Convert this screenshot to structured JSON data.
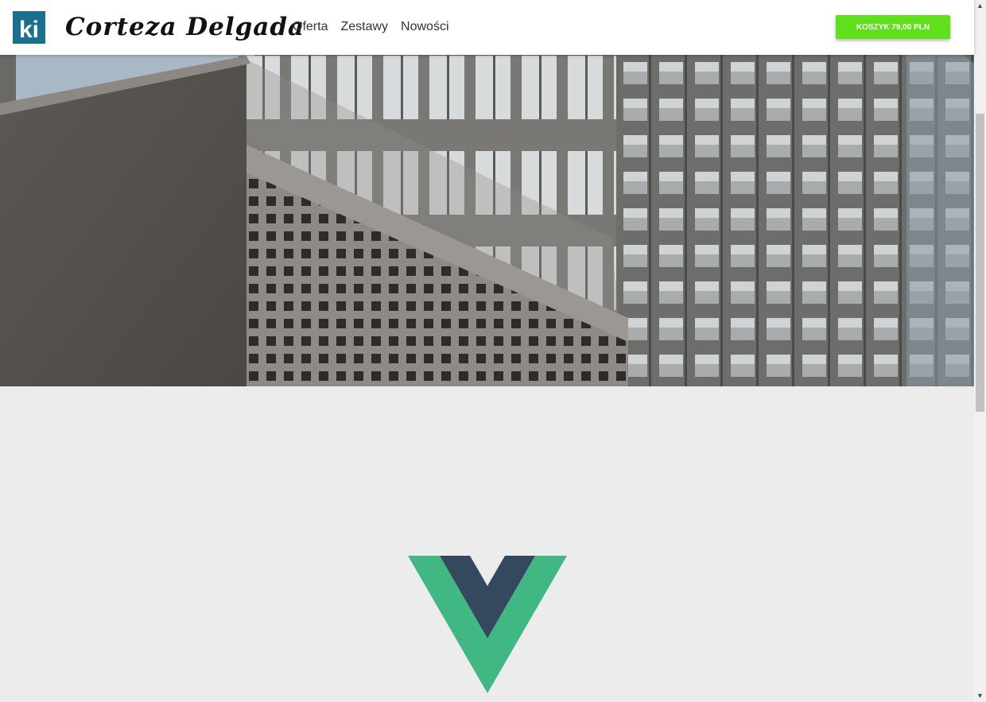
{
  "header": {
    "logo_text": "ki",
    "brand_name": "Corteza Delgada",
    "nav": [
      {
        "label": "Oferta"
      },
      {
        "label": "Zestawy"
      },
      {
        "label": "Nowości"
      }
    ],
    "cart_button_label": "KOSZYK 79,00 PLN"
  },
  "colors": {
    "logo_bg": "#1a6f8c",
    "cart_button_bg": "#5fe01a",
    "page_bg": "#ececec",
    "vue_green": "#41b883",
    "vue_dark": "#34495e"
  },
  "icons": {
    "logo": "ki-logo-icon",
    "main_image": "vue-logo-icon",
    "scroll_up": "chevron-up-icon",
    "scroll_down": "chevron-down-icon"
  }
}
